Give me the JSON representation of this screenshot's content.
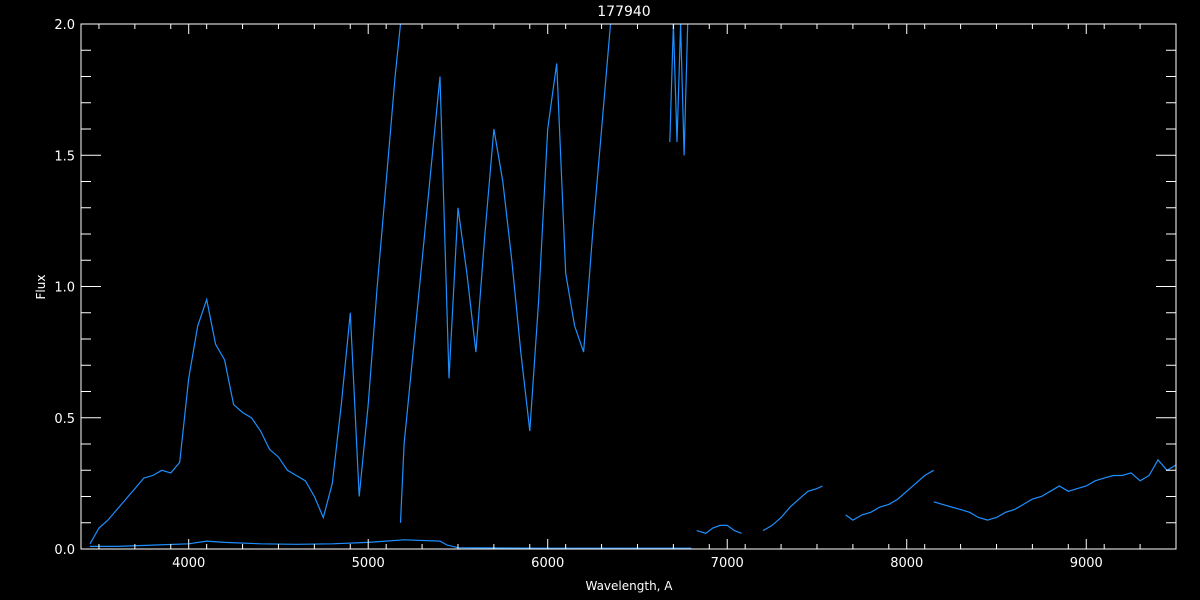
{
  "chart_data": {
    "type": "line",
    "title": "177940",
    "xlabel": "Wavelength, A",
    "ylabel": "Flux",
    "xlim": [
      3400,
      9500
    ],
    "ylim": [
      0,
      2.0
    ],
    "x_ticks": [
      4000,
      5000,
      6000,
      7000,
      8000,
      9000
    ],
    "x_tick_labels": [
      "4000",
      "5000",
      "6000",
      "7000",
      "8000",
      "9000"
    ],
    "y_ticks": [
      0,
      0.5,
      1.0,
      1.5,
      2.0
    ],
    "y_tick_labels": [
      "0.0",
      "0.5",
      "1.0",
      "1.5",
      "2.0"
    ],
    "grid": false,
    "colors": {
      "background": "#000000",
      "axes": "#ffffff",
      "line": "#1e8fff"
    },
    "series": [
      {
        "segments": [
          {
            "x": [
              3450,
              3500,
              3550,
              3600,
              3650,
              3700,
              3750,
              3800,
              3850,
              3900,
              3950,
              4000,
              4050,
              4100,
              4150,
              4200,
              4250,
              4300,
              4350,
              4400,
              4450,
              4500,
              4550,
              4600,
              4650,
              4700,
              4750,
              4800,
              4850,
              4900,
              4950,
              5000,
              5050,
              5100,
              5150,
              5180
            ],
            "y": [
              0.02,
              0.08,
              0.11,
              0.15,
              0.19,
              0.23,
              0.27,
              0.28,
              0.3,
              0.29,
              0.33,
              0.65,
              0.85,
              0.95,
              0.78,
              0.72,
              0.55,
              0.52,
              0.5,
              0.45,
              0.38,
              0.35,
              0.3,
              0.28,
              0.26,
              0.2,
              0.12,
              0.25,
              0.55,
              0.9,
              0.2,
              0.55,
              1.0,
              1.4,
              1.8,
              2.0
            ]
          },
          {
            "x": [
              5180,
              5200,
              5250,
              5300,
              5350,
              5400,
              5450,
              5500,
              5550,
              5600,
              5650,
              5700,
              5750,
              5800,
              5850,
              5900,
              5950,
              6000,
              6050,
              6100,
              6150,
              6200,
              6250,
              6300,
              6350
            ],
            "y": [
              0.1,
              0.4,
              0.75,
              1.1,
              1.45,
              1.8,
              0.65,
              1.3,
              1.05,
              0.75,
              1.2,
              1.6,
              1.4,
              1.1,
              0.75,
              0.45,
              0.95,
              1.6,
              1.85,
              1.05,
              0.85,
              0.75,
              1.2,
              1.6,
              2.0
            ]
          },
          {
            "x": [
              6680,
              6700,
              6720,
              6740,
              6760,
              6780
            ],
            "y": [
              1.55,
              2.0,
              1.55,
              2.0,
              1.5,
              2.0
            ]
          },
          {
            "x": [
              3450,
              3600,
              3800,
              4000,
              4100,
              4200,
              4400,
              4600,
              4800,
              5000,
              5200,
              5400,
              5440,
              5500,
              6000,
              6500,
              6800
            ],
            "y": [
              0.01,
              0.01,
              0.015,
              0.02,
              0.03,
              0.025,
              0.02,
              0.018,
              0.02,
              0.025,
              0.035,
              0.03,
              0.015,
              0.005,
              0.003,
              0.003,
              0.003
            ]
          },
          {
            "x": [
              6830,
              6880,
              6920,
              6960,
              7000,
              7040,
              7080
            ],
            "y": [
              0.07,
              0.06,
              0.08,
              0.09,
              0.09,
              0.07,
              0.06
            ]
          },
          {
            "x": [
              7200,
              7250,
              7300,
              7350,
              7400,
              7450,
              7500,
              7530
            ],
            "y": [
              0.07,
              0.09,
              0.12,
              0.16,
              0.19,
              0.22,
              0.23,
              0.24
            ]
          },
          {
            "x": [
              7660,
              7700,
              7750,
              7800,
              7850,
              7900,
              7950,
              8000,
              8050,
              8100,
              8150
            ],
            "y": [
              0.13,
              0.11,
              0.13,
              0.14,
              0.16,
              0.17,
              0.19,
              0.22,
              0.25,
              0.28,
              0.3
            ]
          },
          {
            "x": [
              8150,
              8200,
              8250,
              8300,
              8350,
              8400,
              8450,
              8500,
              8550,
              8600,
              8650,
              8700,
              8750,
              8800,
              8850,
              8900,
              8950,
              9000,
              9050,
              9100,
              9150,
              9200,
              9250,
              9300,
              9350,
              9400,
              9450,
              9500
            ],
            "y": [
              0.18,
              0.17,
              0.16,
              0.15,
              0.14,
              0.12,
              0.11,
              0.12,
              0.14,
              0.15,
              0.17,
              0.19,
              0.2,
              0.22,
              0.24,
              0.22,
              0.23,
              0.24,
              0.26,
              0.27,
              0.28,
              0.28,
              0.29,
              0.26,
              0.28,
              0.34,
              0.3,
              0.32
            ]
          }
        ]
      }
    ]
  }
}
